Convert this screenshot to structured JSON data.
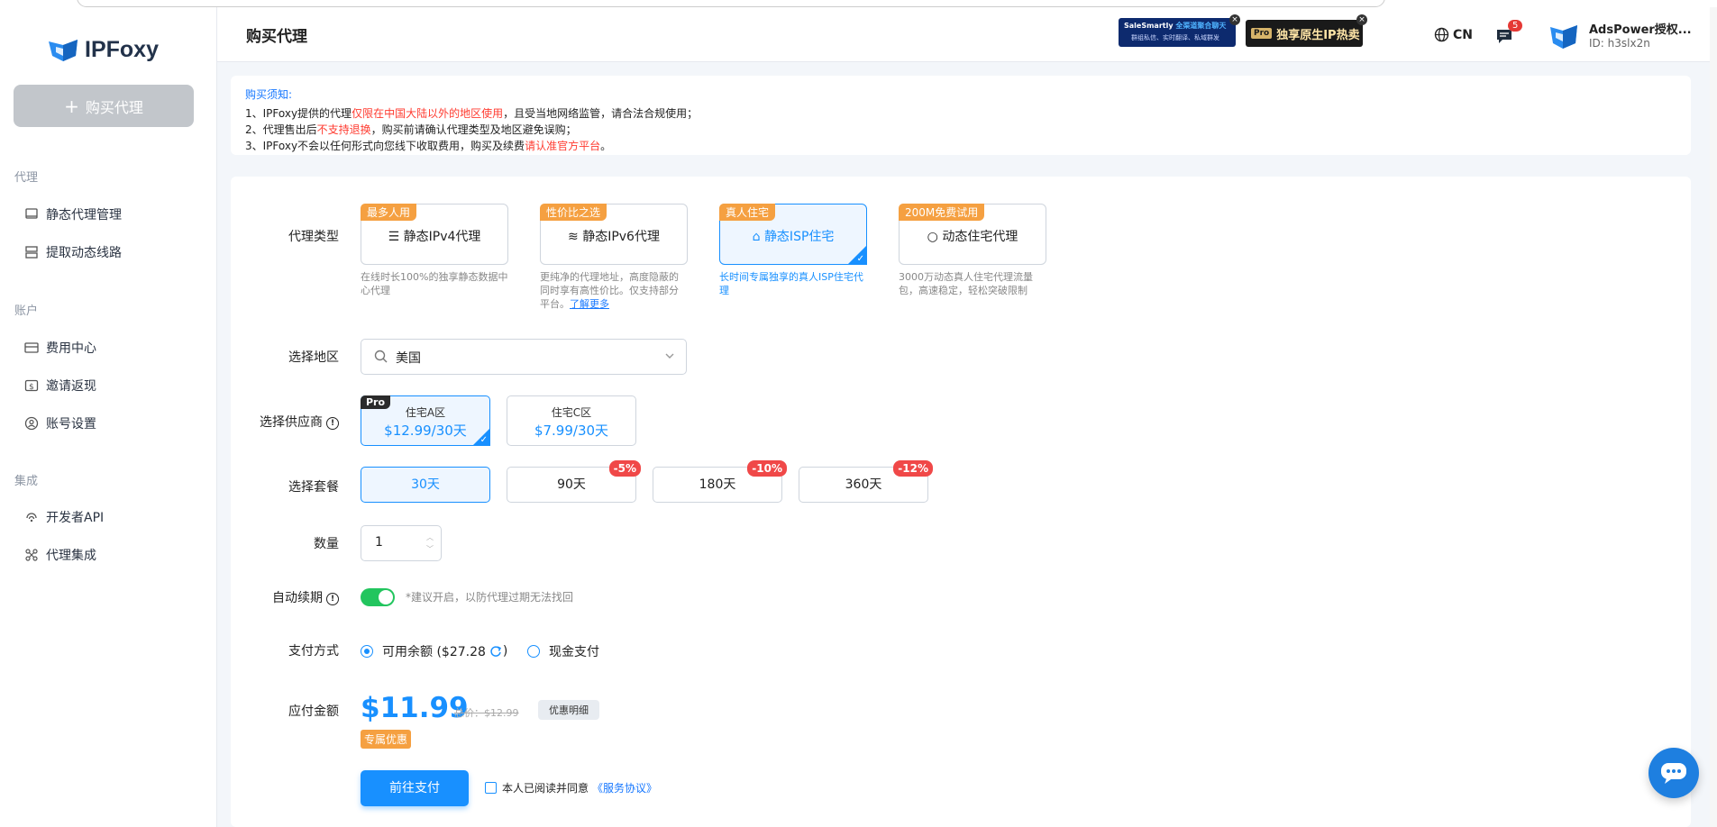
{
  "sidebar": {
    "logo": "IPFoxy",
    "buy_button": "购买代理",
    "sections": [
      {
        "title": "代理",
        "items": [
          {
            "label": "静态代理管理",
            "icon": "monitor-icon"
          },
          {
            "label": "提取动态线路",
            "icon": "server-icon"
          }
        ]
      },
      {
        "title": "账户",
        "items": [
          {
            "label": "费用中心",
            "icon": "card-icon"
          },
          {
            "label": "邀请返现",
            "icon": "dollar-icon"
          },
          {
            "label": "账号设置",
            "icon": "user-icon"
          }
        ]
      },
      {
        "title": "集成",
        "items": [
          {
            "label": "开发者API",
            "icon": "api-icon"
          },
          {
            "label": "代理集成",
            "icon": "integration-icon"
          }
        ]
      }
    ]
  },
  "header": {
    "title": "购买代理",
    "ad1_line1_a": "SaleSmartly",
    "ad1_line1_b": "全渠道聚合聊天",
    "ad1_line2": "群组私信、实时翻译、私域群发",
    "ad2_badge": "Pro",
    "ad2_text": "独享原生IP热卖",
    "lang": "CN",
    "msg_count": "5",
    "user_name": "AdsPower授权...",
    "user_id": "ID: h3slx2n"
  },
  "notice": {
    "title": "购买须知:",
    "line1_a": "1、IPFoxy提供的代理",
    "line1_red": "仅限在中国大陆以外的地区使用",
    "line1_b": "，且受当地网络监管，请合法合规使用；",
    "line2_a": "2、代理售出后",
    "line2_red": "不支持退换",
    "line2_b": "，购买前请确认代理类型及地区避免误购；",
    "line3_a": "3、IPFoxy不会以任何形式向您线下收取费用，购买及续费",
    "line3_red": "请认准官方平台",
    "line3_b": "。"
  },
  "form": {
    "labels": {
      "proxy_type": "代理类型",
      "region": "选择地区",
      "vendor": "选择供应商",
      "plan": "选择套餐",
      "qty": "数量",
      "auto_renew": "自动续期",
      "payment": "支付方式",
      "amount": "应付金额"
    },
    "proxy_types": [
      {
        "tag": "最多人用",
        "name": "静态IPv4代理",
        "desc": "在线时长100%的独享静态数据中心代理"
      },
      {
        "tag": "性价比之选",
        "name": "静态IPv6代理",
        "desc": "更纯净的代理地址，高度隐蔽的同时享有高性价比。仅支持部分平台。",
        "more": "了解更多"
      },
      {
        "tag": "真人住宅",
        "name": "静态ISP住宅",
        "desc": "长时间专属独享的真人ISP住宅代理",
        "selected": true
      },
      {
        "tag": "200M免费试用",
        "name": "动态住宅代理",
        "desc": "3000万动态真人住宅代理流量包，高速稳定，轻松突破限制"
      }
    ],
    "region_value": "美国",
    "vendors": [
      {
        "badge": "Pro",
        "name": "住宅A区",
        "price": "$12.99/30天",
        "selected": true
      },
      {
        "name": "住宅C区",
        "price": "$7.99/30天"
      }
    ],
    "plans": [
      {
        "label": "30天",
        "discount": "",
        "selected": true
      },
      {
        "label": "90天",
        "discount": "-5%"
      },
      {
        "label": "180天",
        "discount": "-10%"
      },
      {
        "label": "360天",
        "discount": "-12%"
      }
    ],
    "qty_value": "1",
    "auto_renew_on": true,
    "auto_renew_tip": "*建议开启，以防代理过期无法找回",
    "payment_options": [
      {
        "label": "可用余额 ($27.28",
        "suffix": ")",
        "selected": true
      },
      {
        "label": "现金支付",
        "selected": false
      }
    ],
    "price": "$11.99",
    "original_price": "总价：$12.99",
    "detail_button": "优惠明细",
    "exclusive_tag": "专属优惠",
    "pay_button": "前往支付",
    "agree_text": "本人已阅读并同意",
    "agree_link": "《服务协议》"
  },
  "colors": {
    "accent": "#1890ff",
    "tag_orange": "#f5a041",
    "discount_red": "#f04848",
    "toggle_green": "#22c55e"
  }
}
